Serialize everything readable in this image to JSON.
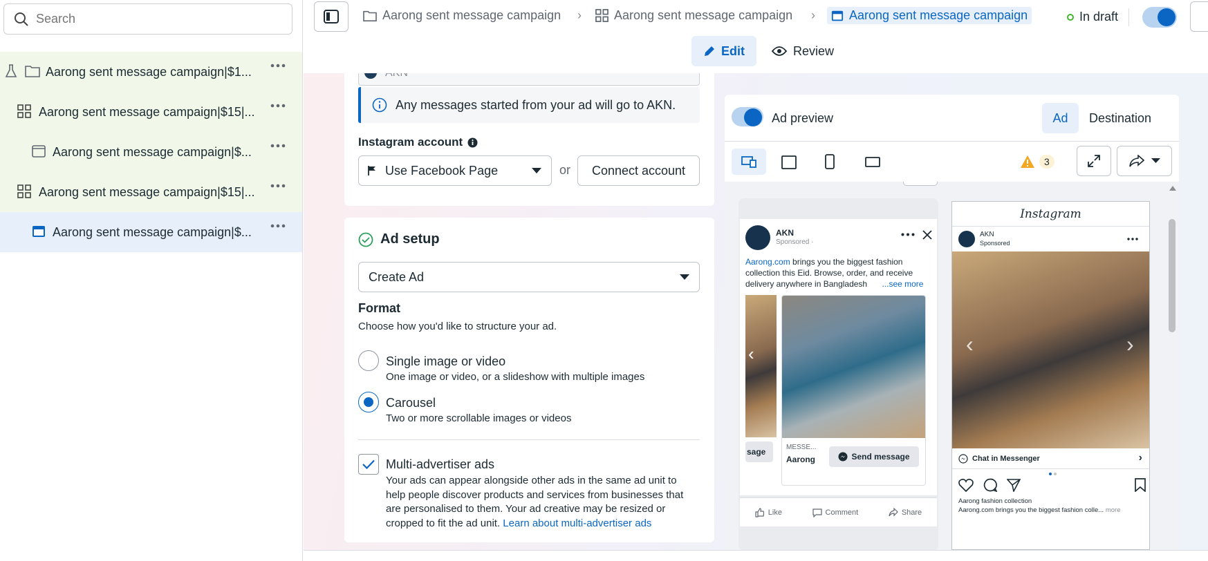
{
  "sidebar": {
    "search_placeholder": "Search",
    "items": [
      {
        "label": "Aarong sent message campaign|$1..."
      },
      {
        "label": "Aarong sent message campaign|$15|..."
      },
      {
        "label": "Aarong sent message campaign|$..."
      },
      {
        "label": "Aarong sent message campaign|$15|..."
      },
      {
        "label": "Aarong sent message campaign|$..."
      }
    ]
  },
  "topbar": {
    "crumbs": [
      "Aarong sent message campaign",
      "Aarong sent message campaign",
      "Aarong sent message campaign"
    ],
    "status": "In draft"
  },
  "mode_tabs": {
    "edit": "Edit",
    "review": "Review"
  },
  "destination_card": {
    "partial_value": "AKN",
    "info_text": "Any messages started from your ad will go to AKN.",
    "instagram_label": "Instagram account",
    "instagram_select": "Use Facebook Page",
    "or": "or",
    "connect_button": "Connect account"
  },
  "ad_setup": {
    "title": "Ad setup",
    "select_value": "Create Ad",
    "format_title": "Format",
    "format_desc": "Choose how you'd like to structure your ad.",
    "options": [
      {
        "label": "Single image or video",
        "desc": "One image or video, or a slideshow with multiple images",
        "selected": false
      },
      {
        "label": "Carousel",
        "desc": "Two or more scrollable images or videos",
        "selected": true
      }
    ],
    "multi_label": "Multi-advertiser ads",
    "multi_desc_lines": [
      "Your ads can appear alongside other ads in the same ad unit to",
      "help people discover products and services from businesses that",
      "are personalised to them. Your ad creative may be resized or"
    ],
    "multi_desc_last": "cropped to fit the ad unit.",
    "multi_link": "Learn about multi-advertiser ads",
    "multi_checked": true
  },
  "preview": {
    "label": "Ad preview",
    "tab_ad": "Ad",
    "tab_destination": "Destination",
    "warning_count": "3",
    "fb": {
      "page": "AKN",
      "sponsored": "Sponsored ·",
      "link": "Aarong.com",
      "text_1": " brings you the biggest fashion",
      "text_2": "collection this Eid. Browse, order, and receive",
      "text_3": "delivery anywhere in Bangladesh",
      "see_more": "...see more",
      "card_left_cta": "sage",
      "card_caption": "MESSE...",
      "card_title": "Aarong",
      "send_message": "Send message",
      "like": "Like",
      "comment": "Comment",
      "share": "Share"
    },
    "ig": {
      "brand": "Instagram",
      "page": "AKN",
      "sponsored": "Sponsored",
      "chat": "Chat in Messenger",
      "caption_title": "Aarong fashion collection",
      "caption_text": "Aarong.com brings you the biggest fashion colle...",
      "more": "more"
    }
  },
  "colors": {
    "accent": "#0a66c2",
    "draft_dot": "#42b72a",
    "warning": "#f5a623"
  }
}
